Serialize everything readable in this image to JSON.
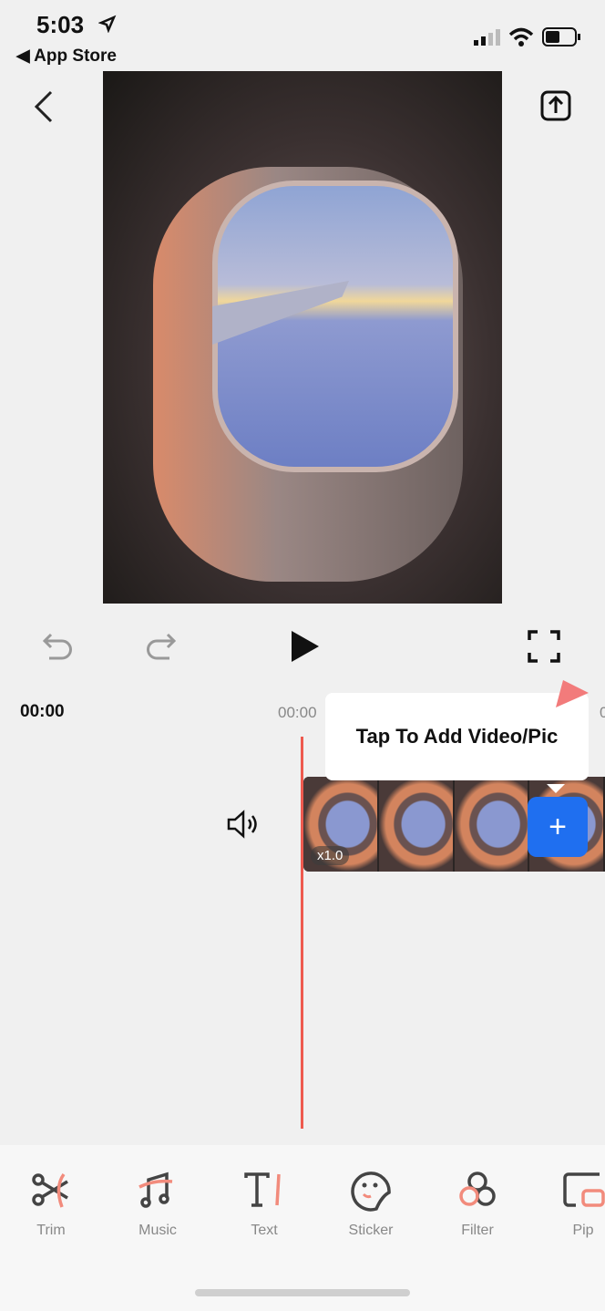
{
  "status": {
    "time": "5:03",
    "back_app": "◀ App Store"
  },
  "timeline": {
    "current_time": "00:00",
    "ruler_time": "00:00",
    "ruler_next": "0"
  },
  "tooltip": {
    "text": "Tap To Add Video/Pic"
  },
  "clip": {
    "speed": "x1.0"
  },
  "add_button": "+",
  "accent": "#ee5a4f",
  "add_color": "#1f6ff0",
  "tools": [
    {
      "label": "Trim",
      "icon": "scissors-icon"
    },
    {
      "label": "Music",
      "icon": "music-icon"
    },
    {
      "label": "Text",
      "icon": "text-icon"
    },
    {
      "label": "Sticker",
      "icon": "sticker-icon"
    },
    {
      "label": "Filter",
      "icon": "filter-icon"
    },
    {
      "label": "Pip",
      "icon": "pip-icon"
    }
  ]
}
